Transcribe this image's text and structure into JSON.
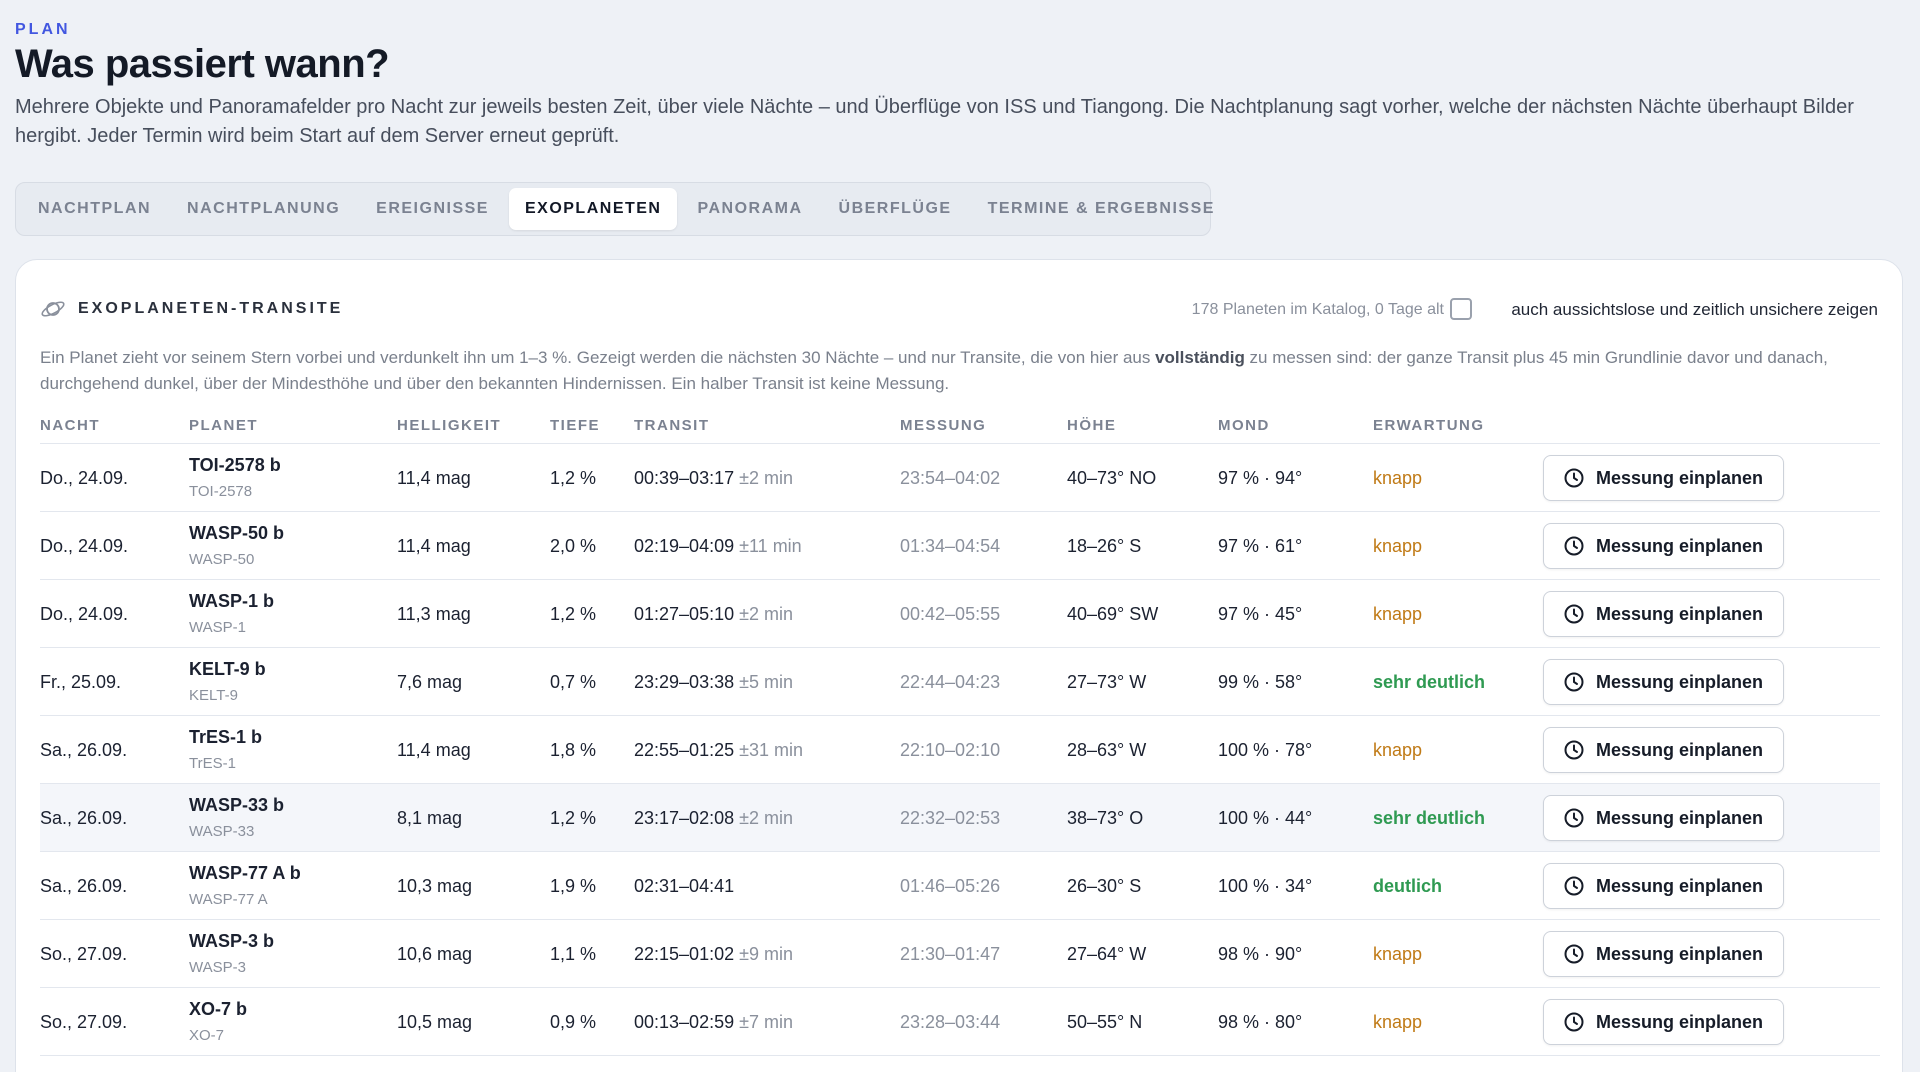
{
  "header": {
    "eyebrow": "PLAN",
    "title": "Was passiert wann?",
    "intro": "Mehrere Objekte und Panoramafelder pro Nacht zur jeweils besten Zeit, über viele Nächte – und Überflüge von ISS und Tiangong. Die Nachtplanung sagt vorher, welche der nächsten Nächte überhaupt Bilder hergibt. Jeder Termin wird beim Start auf dem Server erneut geprüft."
  },
  "tabs": [
    {
      "label": "NACHTPLAN"
    },
    {
      "label": "NACHTPLANUNG"
    },
    {
      "label": "EREIGNISSE"
    },
    {
      "label": "EXOPLANETEN",
      "active": true
    },
    {
      "label": "PANORAMA"
    },
    {
      "label": "ÜBERFLÜGE"
    },
    {
      "label": "TERMINE & ERGEBNISSE"
    }
  ],
  "card": {
    "icon": "planet-icon",
    "title": "EXOPLANETEN-TRANSITE",
    "catalog_info": "178 Planeten im Katalog, 0 Tage alt",
    "checkbox_label": "auch aussichtslose und zeitlich unsichere zeigen",
    "checkbox_checked": false,
    "desc_before": "Ein Planet zieht vor seinem Stern vorbei und verdunkelt ihn um 1–3 %. Gezeigt werden die nächsten 30 Nächte – und nur Transite, die von hier aus ",
    "desc_bold": "vollständig",
    "desc_after": " zu messen sind: der ganze Transit plus 45 min Grundlinie davor und danach, durchgehend dunkel, über der Mindesthöhe und über den bekannten Hindernissen. Ein halber Transit ist keine Messung."
  },
  "table": {
    "columns": {
      "night": "NACHT",
      "planet": "PLANET",
      "brightness": "HELLIGKEIT",
      "depth": "TIEFE",
      "transit": "TRANSIT",
      "measurement": "MESSUNG",
      "altitude": "HÖHE",
      "moon": "MOND",
      "expectation": "ERWARTUNG"
    },
    "action_label": "Messung einplanen",
    "action_icon": "clock-icon",
    "rows": [
      {
        "night": "Do., 24.09.",
        "planet": "TOI-2578 b",
        "star": "TOI-2578",
        "mag": "11,4 mag",
        "depth": "1,2 %",
        "transit": "00:39–03:17",
        "unc": "±2 min",
        "meas": "23:54–04:02",
        "alt": "40–73° NO",
        "moon": "97 % · 94°",
        "exp": "knapp",
        "exp_class": "knapp"
      },
      {
        "night": "Do., 24.09.",
        "planet": "WASP-50 b",
        "star": "WASP-50",
        "mag": "11,4 mag",
        "depth": "2,0 %",
        "transit": "02:19–04:09",
        "unc": "±11 min",
        "meas": "01:34–04:54",
        "alt": "18–26° S",
        "moon": "97 % · 61°",
        "exp": "knapp",
        "exp_class": "knapp"
      },
      {
        "night": "Do., 24.09.",
        "planet": "WASP-1 b",
        "star": "WASP-1",
        "mag": "11,3 mag",
        "depth": "1,2 %",
        "transit": "01:27–05:10",
        "unc": "±2 min",
        "meas": "00:42–05:55",
        "alt": "40–69° SW",
        "moon": "97 % · 45°",
        "exp": "knapp",
        "exp_class": "knapp"
      },
      {
        "night": "Fr., 25.09.",
        "planet": "KELT-9 b",
        "star": "KELT-9",
        "mag": "7,6 mag",
        "depth": "0,7 %",
        "transit": "23:29–03:38",
        "unc": "±5 min",
        "meas": "22:44–04:23",
        "alt": "27–73° W",
        "moon": "99 % · 58°",
        "exp": "sehr deutlich",
        "exp_class": "good"
      },
      {
        "night": "Sa., 26.09.",
        "planet": "TrES-1 b",
        "star": "TrES-1",
        "mag": "11,4 mag",
        "depth": "1,8 %",
        "transit": "22:55–01:25",
        "unc": "±31 min",
        "meas": "22:10–02:10",
        "alt": "28–63° W",
        "moon": "100 % · 78°",
        "exp": "knapp",
        "exp_class": "knapp"
      },
      {
        "night": "Sa., 26.09.",
        "planet": "WASP-33 b",
        "star": "WASP-33",
        "mag": "8,1 mag",
        "depth": "1,2 %",
        "transit": "23:17–02:08",
        "unc": "±2 min",
        "meas": "22:32–02:53",
        "alt": "38–73° O",
        "moon": "100 % · 44°",
        "exp": "sehr deutlich",
        "exp_class": "good",
        "highlight": true
      },
      {
        "night": "Sa., 26.09.",
        "planet": "WASP-77 A b",
        "star": "WASP-77 A",
        "mag": "10,3 mag",
        "depth": "1,9 %",
        "transit": "02:31–04:41",
        "unc": "",
        "meas": "01:46–05:26",
        "alt": "26–30° S",
        "moon": "100 % · 34°",
        "exp": "deutlich",
        "exp_class": "good"
      },
      {
        "night": "So., 27.09.",
        "planet": "WASP-3 b",
        "star": "WASP-3",
        "mag": "10,6 mag",
        "depth": "1,1 %",
        "transit": "22:15–01:02",
        "unc": "±9 min",
        "meas": "21:30–01:47",
        "alt": "27–64° W",
        "moon": "98 % · 90°",
        "exp": "knapp",
        "exp_class": "knapp"
      },
      {
        "night": "So., 27.09.",
        "planet": "XO-7 b",
        "star": "XO-7",
        "mag": "10,5 mag",
        "depth": "0,9 %",
        "transit": "00:13–02:59",
        "unc": "±7 min",
        "meas": "23:28–03:44",
        "alt": "50–55° N",
        "moon": "98 % · 80°",
        "exp": "knapp",
        "exp_class": "knapp"
      }
    ]
  }
}
